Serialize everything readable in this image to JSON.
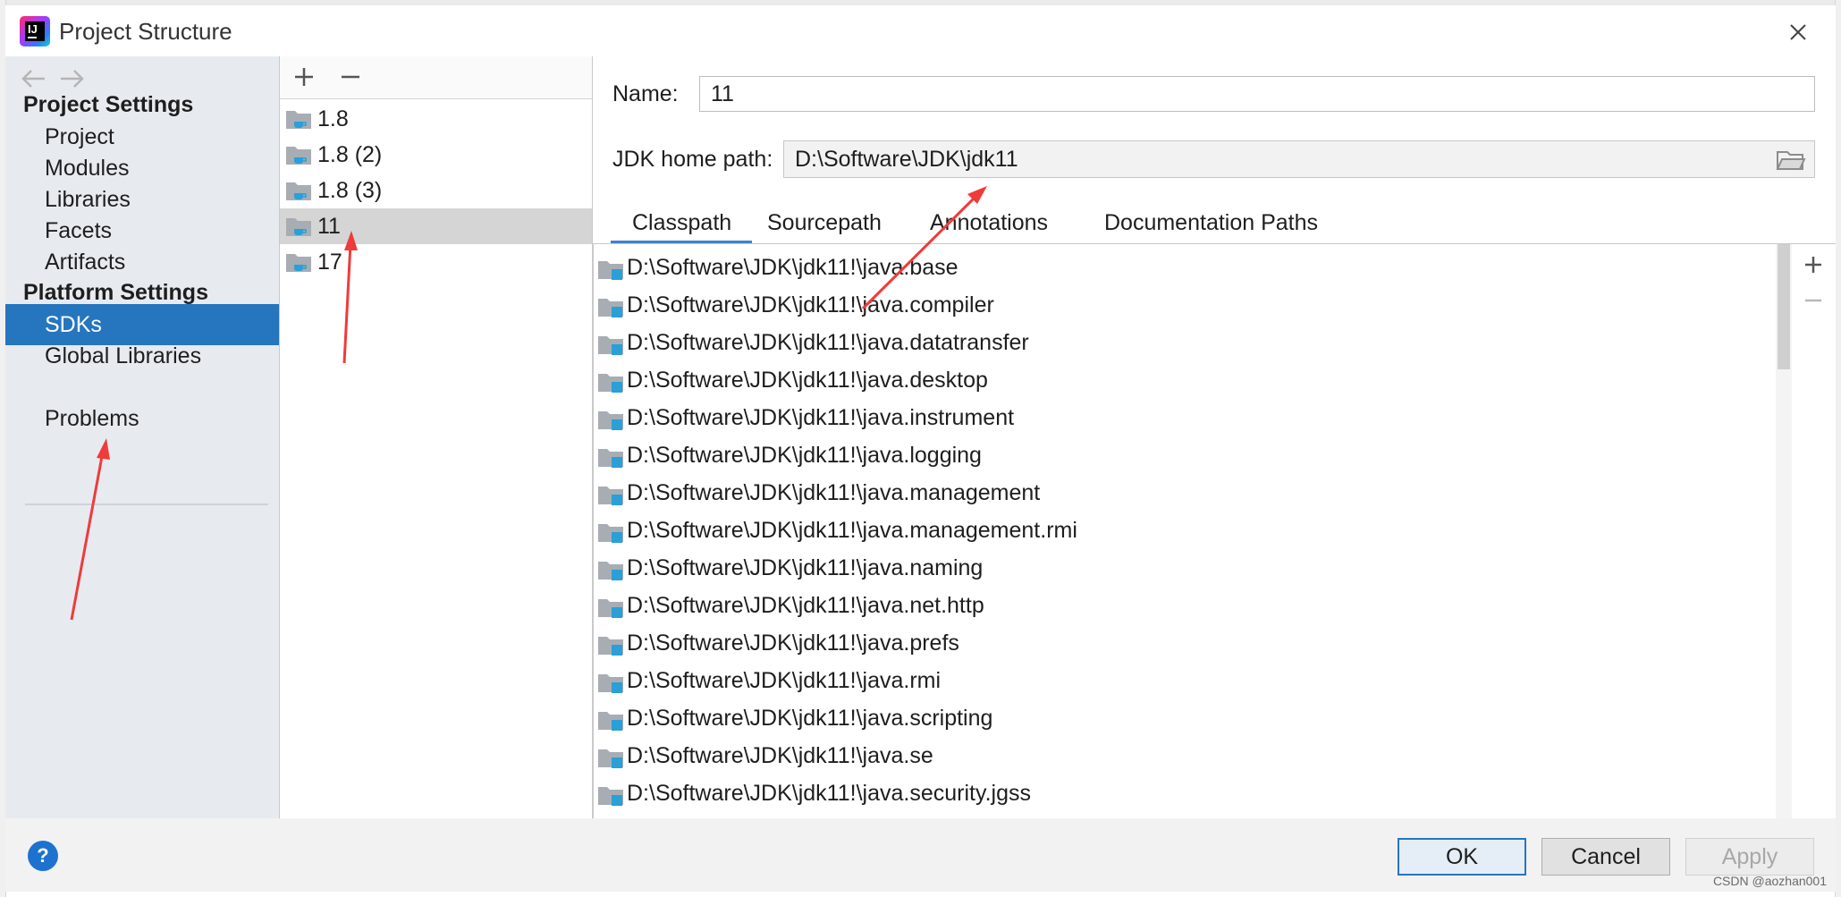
{
  "window": {
    "title": "Project Structure"
  },
  "nav": {
    "project_settings_header": "Project Settings",
    "project_items": [
      "Project",
      "Modules",
      "Libraries",
      "Facets",
      "Artifacts"
    ],
    "platform_settings_header": "Platform Settings",
    "platform_items": [
      "SDKs",
      "Global Libraries"
    ],
    "selected": "SDKs",
    "problems": "Problems"
  },
  "sdks": {
    "items": [
      "1.8",
      "1.8 (2)",
      "1.8 (3)",
      "11",
      "17"
    ],
    "selected": "11"
  },
  "detail": {
    "name_label": "Name:",
    "name_value": "11",
    "jdk_home_label": "JDK home path:",
    "jdk_home_value": "D:\\Software\\JDK\\jdk11",
    "tabs": [
      "Classpath",
      "Sourcepath",
      "Annotations",
      "Documentation Paths"
    ],
    "active_tab": "Classpath",
    "classpath": [
      "D:\\Software\\JDK\\jdk11!\\java.base",
      "D:\\Software\\JDK\\jdk11!\\java.compiler",
      "D:\\Software\\JDK\\jdk11!\\java.datatransfer",
      "D:\\Software\\JDK\\jdk11!\\java.desktop",
      "D:\\Software\\JDK\\jdk11!\\java.instrument",
      "D:\\Software\\JDK\\jdk11!\\java.logging",
      "D:\\Software\\JDK\\jdk11!\\java.management",
      "D:\\Software\\JDK\\jdk11!\\java.management.rmi",
      "D:\\Software\\JDK\\jdk11!\\java.naming",
      "D:\\Software\\JDK\\jdk11!\\java.net.http",
      "D:\\Software\\JDK\\jdk11!\\java.prefs",
      "D:\\Software\\JDK\\jdk11!\\java.rmi",
      "D:\\Software\\JDK\\jdk11!\\java.scripting",
      "D:\\Software\\JDK\\jdk11!\\java.se",
      "D:\\Software\\JDK\\jdk11!\\java.security.jgss"
    ]
  },
  "buttons": {
    "help": "?",
    "ok": "OK",
    "cancel": "Cancel",
    "apply": "Apply"
  },
  "watermark": "CSDN @aozhan001",
  "colors": {
    "accent": "#2675bf",
    "annotation_arrow": "#ef3b3b"
  },
  "icons": [
    "back-arrow-icon",
    "forward-arrow-icon",
    "close-icon",
    "add-icon",
    "remove-icon",
    "jdk-folder-icon",
    "browse-folder-icon",
    "library-folder-icon",
    "help-icon"
  ]
}
